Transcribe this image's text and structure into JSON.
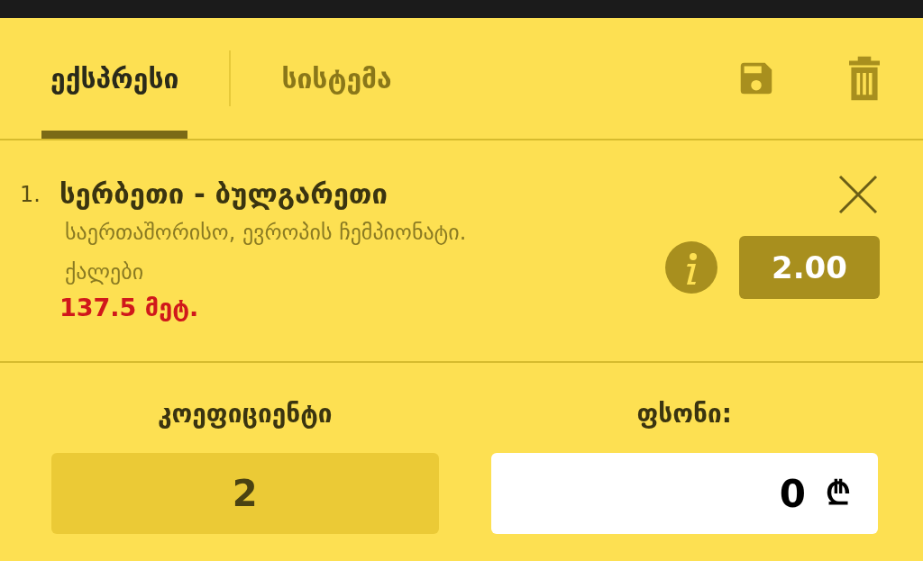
{
  "tabs": [
    {
      "label": "ექსპრესი",
      "selected": true
    },
    {
      "label": "სისტემა",
      "selected": false
    }
  ],
  "bet": {
    "number": "1.",
    "match": "სერბეთი - ბულგარეთი",
    "league": "საერთაშორისო, ევროპის ჩემპიონატი. ქალები",
    "market": "137.5 მეტ.",
    "odds": "2.00"
  },
  "coefficient": {
    "label": "კოეფიციენტი",
    "value": "2"
  },
  "stake": {
    "label": "ფსონი:",
    "value": "0",
    "currency": "₾"
  }
}
